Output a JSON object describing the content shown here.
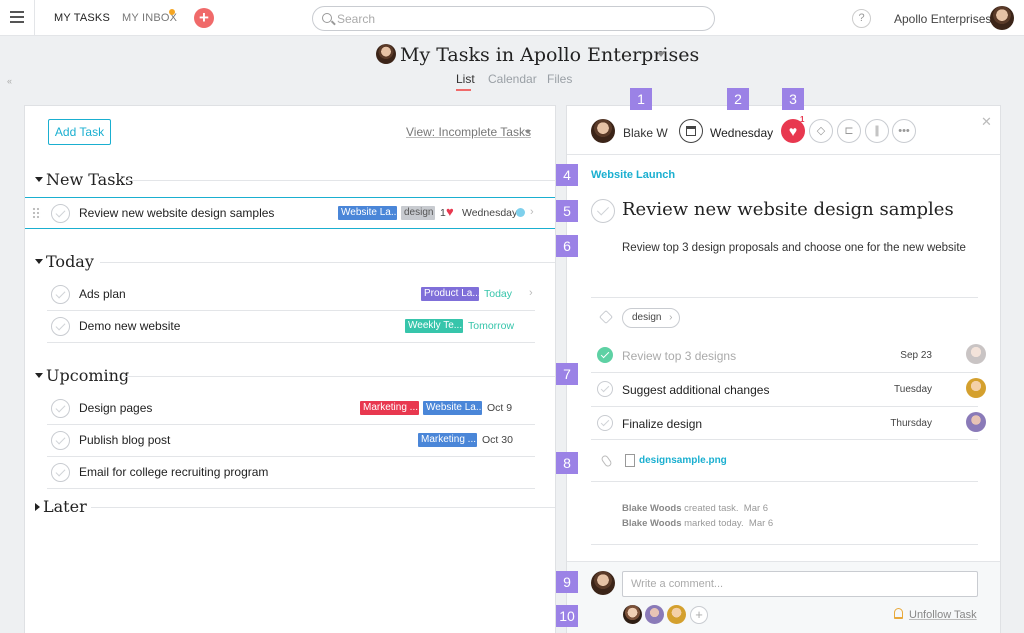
{
  "topbar": {
    "my_tasks": "MY TASKS",
    "my_inbox": "MY INBOX",
    "add": "+",
    "search_placeholder": "Search",
    "help": "?",
    "org": "Apollo Enterprises"
  },
  "header": {
    "title": "My Tasks in Apollo Enterprises",
    "tabs": [
      "List",
      "Calendar",
      "Files"
    ],
    "active_tab": "List"
  },
  "left": {
    "add_task": "Add Task",
    "view_filter": "View: Incomplete Tasks",
    "sections": [
      {
        "name": "New Tasks",
        "tasks": [
          {
            "name": "Review new website design samples",
            "tags": [
              {
                "label": "Website La...",
                "color": "#4a86d8"
              },
              {
                "label": "design",
                "color": "#c8cbd0"
              }
            ],
            "likes": "1",
            "due": "Wednesday",
            "due_color": "#444444"
          }
        ]
      },
      {
        "name": "Today",
        "tasks": [
          {
            "name": "Ads plan",
            "tags": [
              {
                "label": "Product La...",
                "color": "#7f6fd9"
              }
            ],
            "due": "Today",
            "due_color": "#37c5ab"
          },
          {
            "name": "Demo new website",
            "tags": [
              {
                "label": "Weekly Te...",
                "color": "#37c5ab"
              }
            ],
            "due": "Tomorrow",
            "due_color": "#37c5ab"
          }
        ]
      },
      {
        "name": "Upcoming",
        "tasks": [
          {
            "name": "Design pages",
            "tags": [
              {
                "label": "Marketing ...",
                "color": "#e8384f"
              },
              {
                "label": "Website La...",
                "color": "#4a86d8"
              }
            ],
            "due": "Oct 9",
            "due_color": "#444444"
          },
          {
            "name": "Publish blog post",
            "tags": [
              {
                "label": "Marketing ...",
                "color": "#4a86d8"
              }
            ],
            "due": "Oct 30",
            "due_color": "#444444"
          },
          {
            "name": "Email for college recruiting program",
            "tags": [],
            "due": "",
            "due_color": "#444444"
          }
        ]
      },
      {
        "name": "Later",
        "tasks": []
      }
    ]
  },
  "detail": {
    "assignee": "Blake W",
    "due": "Wednesday",
    "likes": "1",
    "project": "Website Launch",
    "title": "Review new website design samples",
    "description": "Review top 3 design proposals and choose one for the new website",
    "tag": "design",
    "subtasks": [
      {
        "name": "Review top 3 designs",
        "due": "Sep 23",
        "done": true
      },
      {
        "name": "Suggest additional changes",
        "due": "Tuesday",
        "done": false
      },
      {
        "name": "Finalize design",
        "due": "Thursday",
        "done": false
      }
    ],
    "attachment": "designsample.png",
    "stories": [
      {
        "who": "Blake Woods",
        "what": "created task.",
        "when": "Mar 6"
      },
      {
        "who": "Blake Woods",
        "what": "marked today.",
        "when": "Mar 6"
      }
    ],
    "comment_placeholder": "Write a comment...",
    "unfollow": "Unfollow Task",
    "add_follower": "+"
  },
  "callouts": [
    "1",
    "2",
    "3",
    "4",
    "5",
    "6",
    "7",
    "8",
    "9",
    "10"
  ],
  "colors": {
    "accent": "#1aafd0",
    "callout": "#9b82e6",
    "heart": "#e8384f"
  }
}
